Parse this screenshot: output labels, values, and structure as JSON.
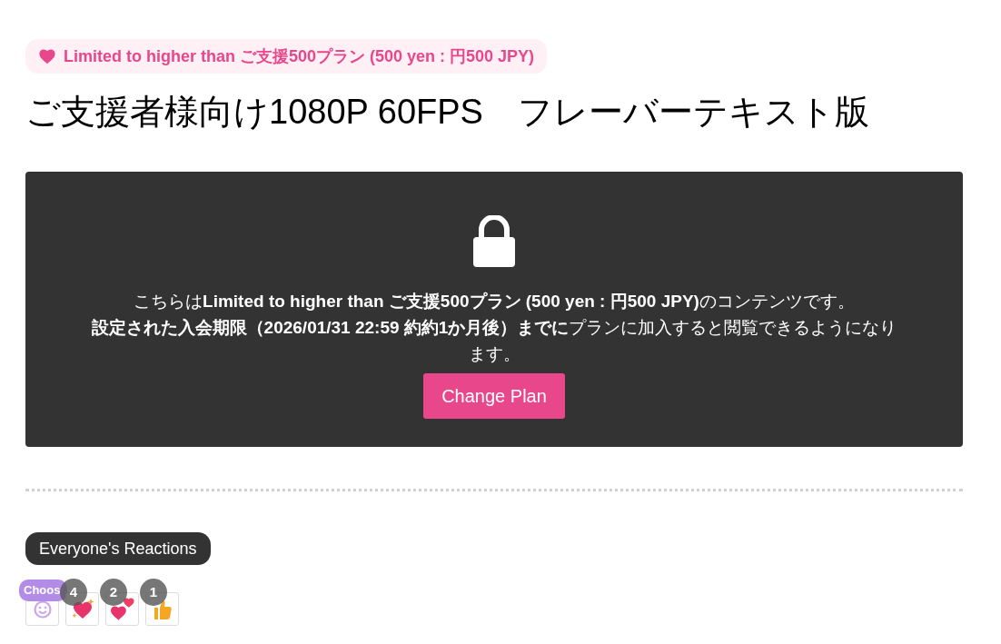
{
  "plan_badge": "Limited to higher than ご支援500プラン (500 yen : 円500 JPY)",
  "title": "ご支援者様向け1080P 60FPS　フレーバーテキスト版",
  "locked_panel": {
    "message": "こちらは**Limited to higher than ご支援500プラン (500 yen : 円500 JPY)**のコンテンツです。",
    "deadline": "**設定された入会期限（2026/01/31 22:59 約約1か月後）までに**プランに加入すると閲覧できるようになります。",
    "button": "Change Plan"
  },
  "reactions_heading": "Everyone's Reactions",
  "reactions": [
    {
      "kind": "choose",
      "tooltip": "Choos"
    },
    {
      "kind": "sparkle-heart",
      "count": "4"
    },
    {
      "kind": "double-heart",
      "count": "2"
    },
    {
      "kind": "thumb",
      "count": "1"
    }
  ]
}
